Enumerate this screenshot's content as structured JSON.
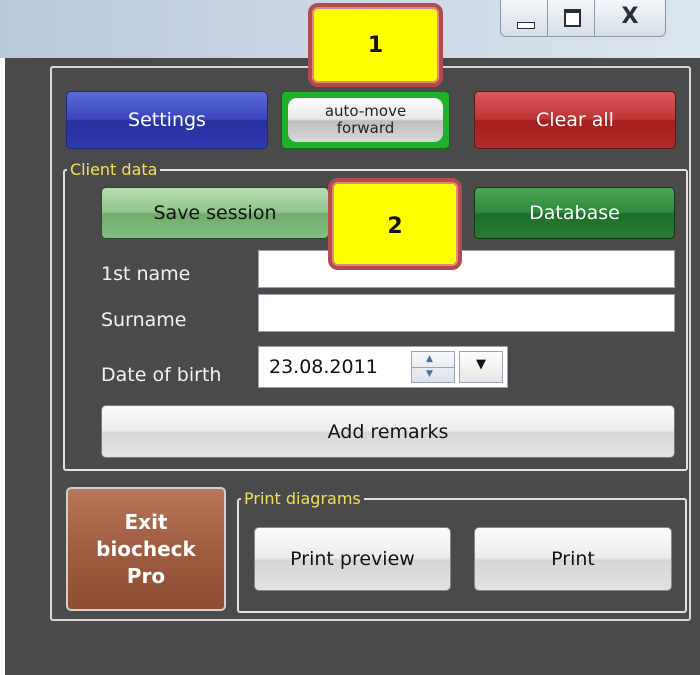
{
  "window": {
    "close_glyph": "X"
  },
  "toolbar": {
    "settings_label": "Settings",
    "automove_label": "auto-move\nforward",
    "clear_label": "Clear  all"
  },
  "client": {
    "group_title": "Client data",
    "save_label": "Save session",
    "database_label": "Database",
    "first_name_label": "1st name",
    "first_name_value": "",
    "surname_label": "Surname",
    "surname_value": "",
    "dob_label": "Date of birth",
    "dob_value": "23.08.2011",
    "remarks_label": "Add remarks"
  },
  "exit_label": "Exit\nbiocheck\nPro",
  "print": {
    "group_title": "Print diagrams",
    "preview_label": "Print preview",
    "print_label": "Print"
  },
  "callouts": {
    "one": "1",
    "two": "2"
  },
  "colors": {
    "accent": "#f0e060",
    "automove_green": "#1fb12a",
    "callout_fill": "#ffff00"
  }
}
